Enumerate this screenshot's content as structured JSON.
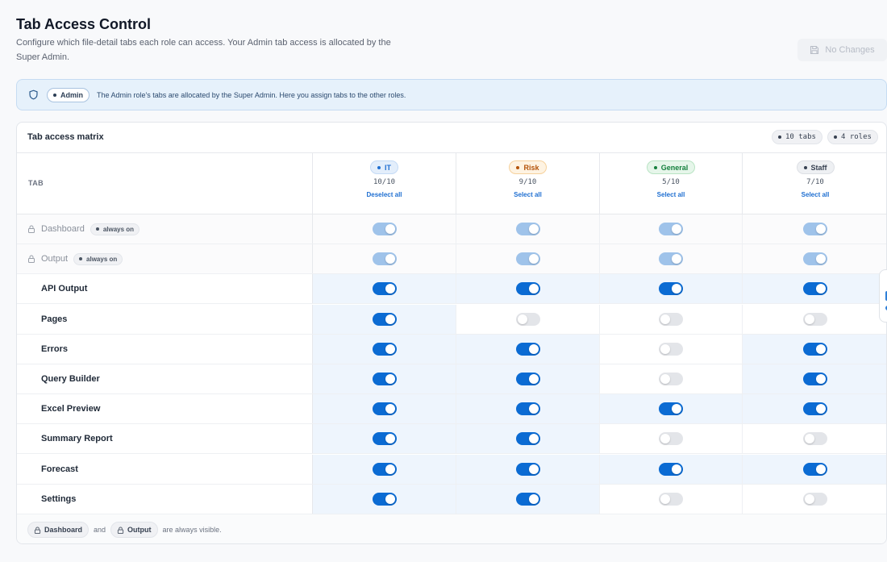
{
  "header": {
    "title": "Tab Access Control",
    "description": "Configure which file-detail tabs each role can access. Your Admin tab access is allocated by the Super Admin.",
    "save_label": "No Changes"
  },
  "banner": {
    "role_badge": "Admin",
    "message": "The Admin role's tabs are allocated by the Super Admin. Here you assign tabs to the other roles."
  },
  "matrix": {
    "title": "Tab access matrix",
    "tabs_chip": "10 tabs",
    "roles_chip": "4 roles",
    "tab_column_header": "TAB",
    "always_on_label": "always on",
    "roles": [
      {
        "name": "IT",
        "count": "10/10",
        "action": "Deselect all",
        "color": "#1f6fd1",
        "bg": "#e3eefb",
        "border": "#c4daf5"
      },
      {
        "name": "Risk",
        "count": "9/10",
        "action": "Select all",
        "color": "#b45309",
        "bg": "#fef3e2",
        "border": "#f6d19c"
      },
      {
        "name": "General",
        "count": "5/10",
        "action": "Select all",
        "color": "#15803d",
        "bg": "#e6f6ea",
        "border": "#b9e4c4"
      },
      {
        "name": "Staff",
        "count": "7/10",
        "action": "Select all",
        "color": "#374151",
        "bg": "#eef0f3",
        "border": "#dde0e5"
      }
    ],
    "rows": [
      {
        "name": "Dashboard",
        "locked": true,
        "values": [
          true,
          true,
          true,
          true
        ]
      },
      {
        "name": "Output",
        "locked": true,
        "values": [
          true,
          true,
          true,
          true
        ]
      },
      {
        "name": "API Output",
        "locked": false,
        "values": [
          true,
          true,
          true,
          true
        ]
      },
      {
        "name": "Pages",
        "locked": false,
        "values": [
          true,
          false,
          false,
          false
        ]
      },
      {
        "name": "Errors",
        "locked": false,
        "values": [
          true,
          true,
          false,
          true
        ]
      },
      {
        "name": "Query Builder",
        "locked": false,
        "values": [
          true,
          true,
          false,
          true
        ]
      },
      {
        "name": "Excel Preview",
        "locked": false,
        "values": [
          true,
          true,
          true,
          true
        ]
      },
      {
        "name": "Summary Report",
        "locked": false,
        "values": [
          true,
          true,
          false,
          false
        ]
      },
      {
        "name": "Forecast",
        "locked": false,
        "values": [
          true,
          true,
          true,
          true
        ]
      },
      {
        "name": "Settings",
        "locked": false,
        "values": [
          true,
          true,
          false,
          false
        ]
      }
    ]
  },
  "footer": {
    "chip_1": "Dashboard",
    "conjunction": "and",
    "chip_2": "Output",
    "suffix": "are always visible."
  }
}
